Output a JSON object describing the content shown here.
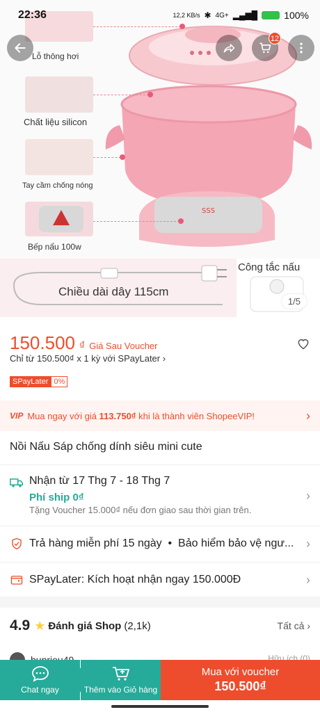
{
  "status": {
    "time": "22:36",
    "net_speed": "12,2 KB/s",
    "network": "4G+",
    "battery": "100%"
  },
  "gallery": {
    "features": [
      {
        "label": "Lỗ thông hơi"
      },
      {
        "label": "Chất liệu silicon"
      },
      {
        "label": "Tay cầm chống nóng"
      },
      {
        "label": "Bếp nấu 100w"
      }
    ],
    "cord_label": "Chiều dài dây 115cm",
    "switch_label": "Công tắc nấu",
    "pager": "1/5",
    "cart_count": "12"
  },
  "price": {
    "value": "150.500",
    "currency": "₫",
    "pay_later_tag": "Giá Sau Voucher",
    "installment": "Chỉ từ 150.500₫ x 1 kỳ với SPayLater ›",
    "badge_name": "SPayLater",
    "badge_rate": "0%"
  },
  "vip": {
    "icon": "VIP",
    "text_pre": "Mua ngay với giá ",
    "text_price": "113.750₫",
    "text_post": " khi là thành viên ShopeeVIP!"
  },
  "product": {
    "title": "Nồi Nấu Sáp chống dính siêu mini cute"
  },
  "shipping": {
    "eta": "Nhận từ 17 Thg 7 - 18 Thg 7",
    "fee": "Phí ship 0₫",
    "voucher": "Tặng Voucher 15.000₫ nếu đơn giao sau thời gian trên."
  },
  "returns": {
    "text": "Trả hàng miễn phí 15 ngày  •  Bảo hiểm bảo vệ ngư..."
  },
  "spaylater": {
    "text": "SPayLater: Kích hoạt nhận ngay 150.000Đ"
  },
  "rating": {
    "score": "4.9",
    "label": "Đánh giá Shop",
    "count": "(2,1k)",
    "all": "Tất cả",
    "reviewer": "bunrieu49",
    "reviewer_meta": "Hữu ích (0)"
  },
  "bottom": {
    "chat": "Chat ngay",
    "add_cart": "Thêm vào Giỏ hàng",
    "buy_line1": "Mua với voucher",
    "buy_line2": "150.500₫"
  },
  "colors": {
    "primary": "#ee4d2d",
    "teal": "#26aa99"
  }
}
